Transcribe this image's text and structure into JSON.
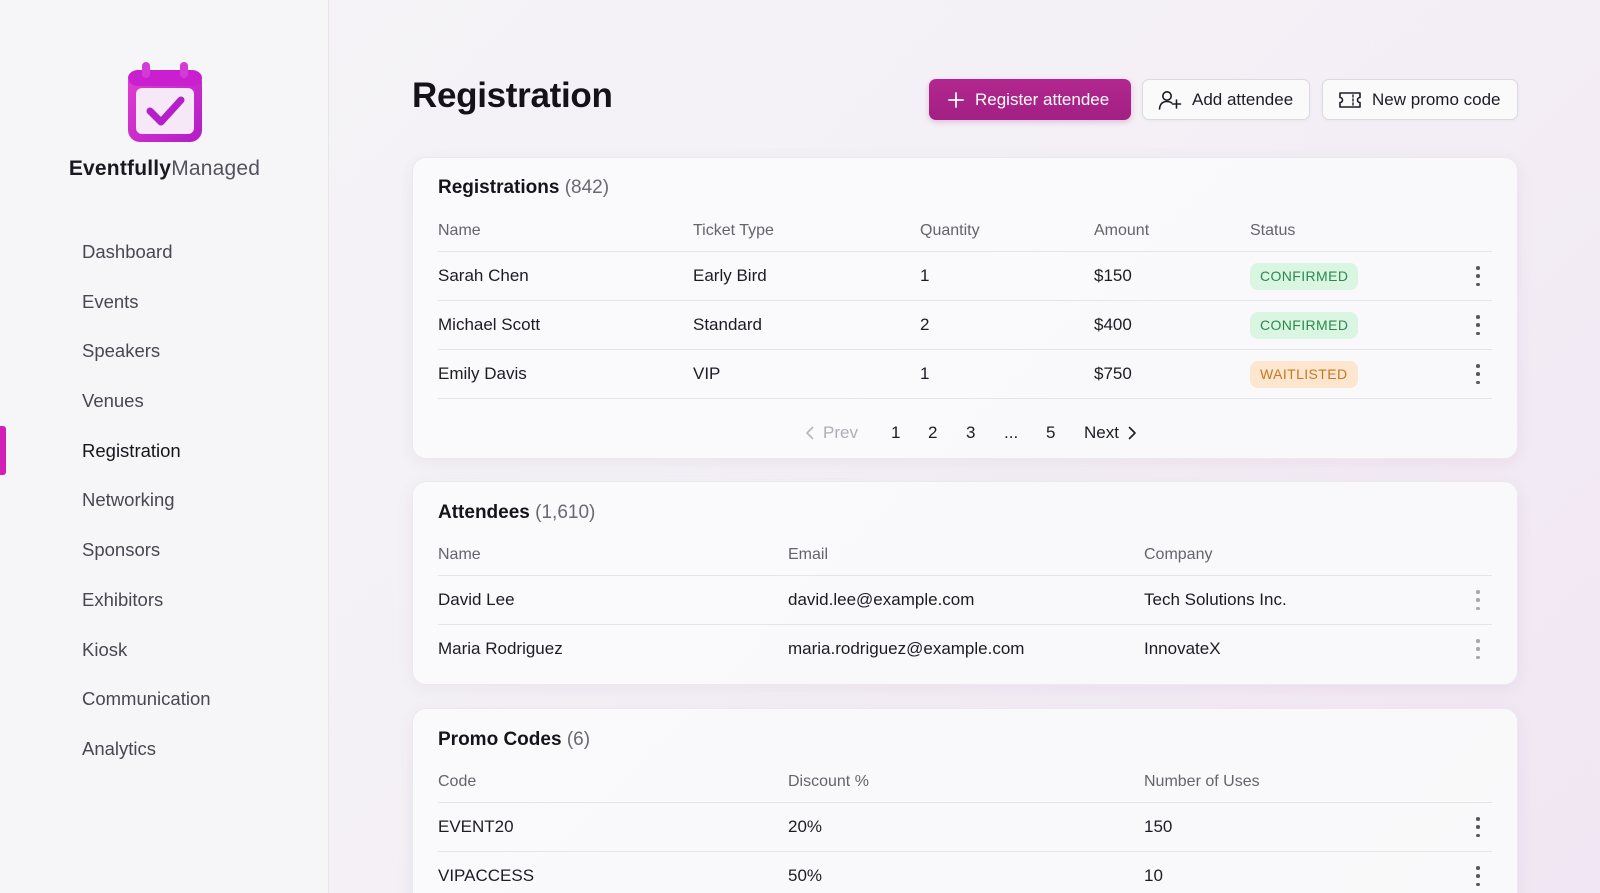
{
  "app": {
    "brand_bold": "Eventfully",
    "brand_light": "Managed",
    "accent_color": "#d21fb6",
    "primary_button_color": "#a9238a"
  },
  "sidebar": {
    "items": [
      {
        "label": "Dashboard",
        "active": false
      },
      {
        "label": "Events",
        "active": false
      },
      {
        "label": "Speakers",
        "active": false
      },
      {
        "label": "Venues",
        "active": false
      },
      {
        "label": "Registration",
        "active": true
      },
      {
        "label": "Networking",
        "active": false
      },
      {
        "label": "Sponsors",
        "active": false
      },
      {
        "label": "Exhibitors",
        "active": false
      },
      {
        "label": "Kiosk",
        "active": false
      },
      {
        "label": "Communication",
        "active": false
      },
      {
        "label": "Analytics",
        "active": false
      }
    ]
  },
  "header": {
    "title": "Registration",
    "buttons": {
      "register": "Register attendee",
      "add": "Add attendee",
      "promo": "New promo code"
    }
  },
  "registrations": {
    "title": "Registrations",
    "count": "(842)",
    "columns": [
      "Name",
      "Ticket Type",
      "Quantity",
      "Amount",
      "Status"
    ],
    "rows": [
      {
        "name": "Sarah Chen",
        "ticket": "Early Bird",
        "qty": "1",
        "amount": "$150",
        "status": "CONFIRMED",
        "status_kind": "green"
      },
      {
        "name": "Michael Scott",
        "ticket": "Standard",
        "qty": "2",
        "amount": "$400",
        "status": "CONFIRMED",
        "status_kind": "green"
      },
      {
        "name": "Emily Davis",
        "ticket": "VIP",
        "qty": "1",
        "amount": "$750",
        "status": "WAITLISTED",
        "status_kind": "orange"
      }
    ],
    "pagination": {
      "prev": "Prev",
      "pages": [
        "1",
        "2",
        "3",
        "...",
        "5"
      ],
      "next": "Next"
    }
  },
  "attendees": {
    "title": "Attendees",
    "count": "(1,610)",
    "columns": [
      "Name",
      "Email",
      "Company"
    ],
    "rows": [
      {
        "name": "David Lee",
        "email": "david.lee@example.com",
        "company": "Tech Solutions Inc."
      },
      {
        "name": "Maria Rodriguez",
        "email": "maria.rodriguez@example.com",
        "company": "InnovateX"
      }
    ]
  },
  "promo_codes": {
    "title": "Promo Codes",
    "count": "(6)",
    "columns": [
      "Code",
      "Discount %",
      "Number of Uses"
    ],
    "rows": [
      {
        "code": "EVENT20",
        "discount": "20%",
        "uses": "150"
      },
      {
        "code": "VIPACCESS",
        "discount": "50%",
        "uses": "10"
      }
    ]
  }
}
